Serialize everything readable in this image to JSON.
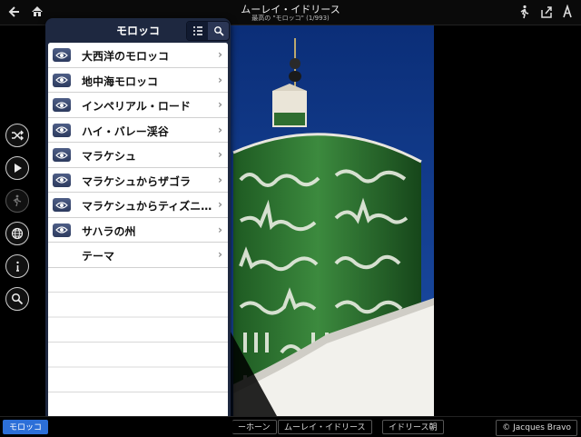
{
  "header": {
    "title": "ムーレイ・イドリース",
    "subtitle": "最高の \"モロッコ\" (1/993)",
    "back_icon": "back-arrow-icon",
    "home_icon": "home-icon",
    "walk_icon": "walk-icon",
    "share_icon": "share-icon",
    "text_icon": "font-size-icon"
  },
  "side_toolbar": {
    "buttons": [
      "shuffle-icon",
      "play-icon",
      "walk-icon",
      "globe-icon",
      "info-icon",
      "search-icon"
    ]
  },
  "popover": {
    "title": "モロッコ",
    "segments": [
      "list-icon",
      "search-icon"
    ],
    "items": [
      {
        "label": "大西洋のモロッコ",
        "icon": "eye-icon"
      },
      {
        "label": "地中海モロッコ",
        "icon": "eye-icon"
      },
      {
        "label": "インペリアル・ロード",
        "icon": "eye-icon"
      },
      {
        "label": "ハイ・バレー渓谷",
        "icon": "eye-icon"
      },
      {
        "label": "マラケシュ",
        "icon": "eye-icon"
      },
      {
        "label": "マラケシュからザゴラ",
        "icon": "eye-icon"
      },
      {
        "label": "マラケシュからティズニ…",
        "icon": "eye-icon"
      },
      {
        "label": "サハラの州",
        "icon": "eye-icon"
      },
      {
        "label": "テーマ",
        "icon": ""
      }
    ]
  },
  "breadcrumbs": [
    "モロッコ",
    "ーホーン",
    "ムーレイ・イドリース",
    "イドリース朝"
  ],
  "credit": "© Jacques Bravo",
  "colors": {
    "accent": "#2c6fd8",
    "popover_bg": "#1e2840",
    "tile_green": "#2f7a32",
    "sky": "#0f3a8a"
  }
}
